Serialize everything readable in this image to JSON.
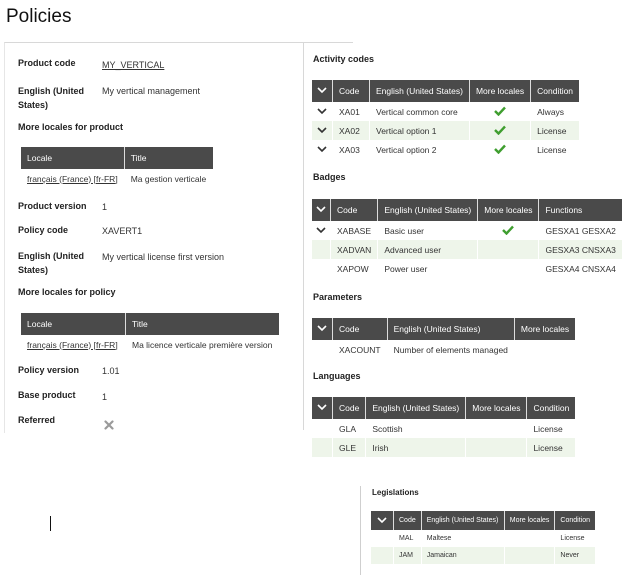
{
  "page": {
    "title": "Policies"
  },
  "product": {
    "code_label": "Product code",
    "code_value": "MY_VERTICAL",
    "english_label": "English (United States)",
    "english_value": "My vertical management",
    "more_locales_label": "More locales for product",
    "locales_columns": [
      "Locale",
      "Title"
    ],
    "locales_rows": [
      {
        "locale": "français (France) [fr-FR]",
        "title": "Ma gestion verticale"
      }
    ],
    "version_label": "Product version",
    "version_value": "1"
  },
  "policy": {
    "code_label": "Policy code",
    "code_value": "XAVERT1",
    "english_label": "English (United States)",
    "english_value": "My vertical license first version",
    "more_locales_label": "More locales for policy",
    "locales_columns": [
      "Locale",
      "Title"
    ],
    "locales_rows": [
      {
        "locale": "français (France) [fr-FR]",
        "title": "Ma licence verticale première version"
      }
    ],
    "version_label": "Policy version",
    "version_value": "1.01",
    "base_product_label": "Base product",
    "base_product_value": "1",
    "referred_label": "Referred"
  },
  "activity_codes": {
    "title": "Activity codes",
    "columns": [
      "Code",
      "English (United States)",
      "More locales",
      "Condition"
    ],
    "rows": [
      {
        "code": "XA01",
        "english": "Vertical common core",
        "more_locales": true,
        "condition": "Always"
      },
      {
        "code": "XA02",
        "english": "Vertical option 1",
        "more_locales": true,
        "condition": "License"
      },
      {
        "code": "XA03",
        "english": "Vertical option 2",
        "more_locales": true,
        "condition": "License"
      }
    ]
  },
  "badges": {
    "title": "Badges",
    "columns": [
      "Code",
      "English (United States)",
      "More locales",
      "Functions"
    ],
    "rows": [
      {
        "code": "XABASE",
        "english": "Basic user",
        "more_locales": true,
        "functions": "GESXA1 GESXA2"
      },
      {
        "code": "XADVAN",
        "english": "Advanced user",
        "more_locales": false,
        "functions": "GESXA3 CNSXA3"
      },
      {
        "code": "XAPOW",
        "english": "Power user",
        "more_locales": false,
        "functions": "GESXA4 CNSXA4"
      }
    ]
  },
  "parameters": {
    "title": "Parameters",
    "columns": [
      "Code",
      "English (United States)",
      "More locales"
    ],
    "rows": [
      {
        "code": "XACOUNT",
        "english": "Number of elements managed"
      }
    ]
  },
  "languages": {
    "title": "Languages",
    "columns": [
      "Code",
      "English (United States)",
      "More locales",
      "Condition"
    ],
    "rows": [
      {
        "code": "GLA",
        "english": "Scottish",
        "condition": "License"
      },
      {
        "code": "GLE",
        "english": "Irish",
        "condition": "License"
      }
    ]
  },
  "legislations": {
    "title": "Legislations",
    "columns": [
      "Code",
      "English (United States)",
      "More locales",
      "Condition"
    ],
    "rows": [
      {
        "code": "MAL",
        "english": "Maltese",
        "condition": "License"
      },
      {
        "code": "JAM",
        "english": "Jamaican",
        "condition": "Never"
      }
    ]
  },
  "colors": {
    "header_bg": "#4a4a4a",
    "row_alt": "#eef5ea",
    "check_green": "#3f9e2f"
  },
  "icons": {
    "expand": "chevron-down-icon",
    "check": "check-icon",
    "referred": "close-x-icon"
  }
}
